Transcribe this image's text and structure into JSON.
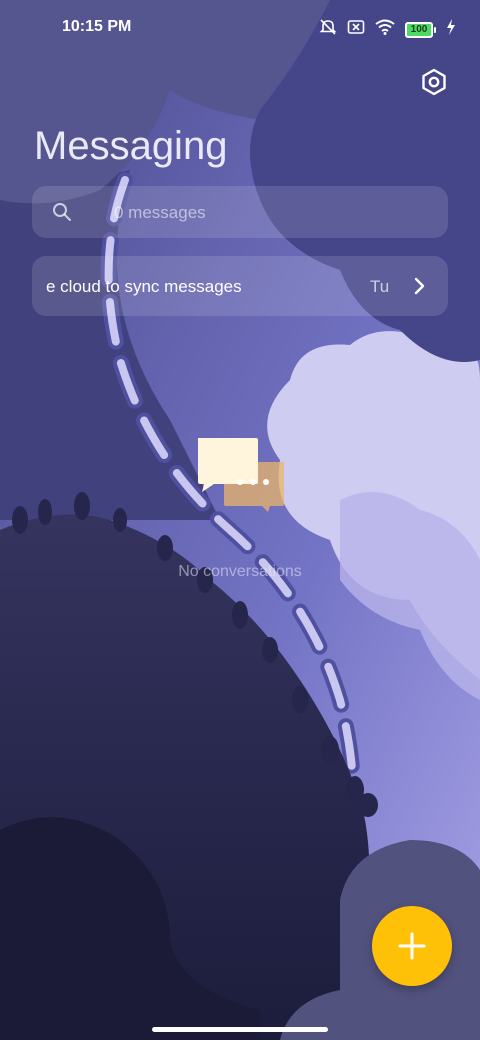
{
  "status_bar": {
    "time": "10:15 PM",
    "battery": "100",
    "icons": [
      "alarm-off-icon",
      "no-sim-icon",
      "wifi-icon",
      "battery-icon",
      "charging-icon"
    ]
  },
  "header": {
    "title": "Messaging",
    "settings_icon": "settings-hexagon-icon"
  },
  "search": {
    "placeholder": "0 messages",
    "icon": "search-icon"
  },
  "sync_banner": {
    "message": "e cloud to sync messages",
    "action": "Tu",
    "icon": "chevron-right-icon"
  },
  "empty_state": {
    "text": "No conversations",
    "icon": "chat-bubbles-icon"
  },
  "fab": {
    "icon": "plus-icon",
    "color": "#ffc107"
  },
  "colors": {
    "background": "#5a5aa8",
    "dark_foliage": "#2a2a52",
    "cloud_light": "#c8c6ee",
    "accent": "#ffc107"
  }
}
